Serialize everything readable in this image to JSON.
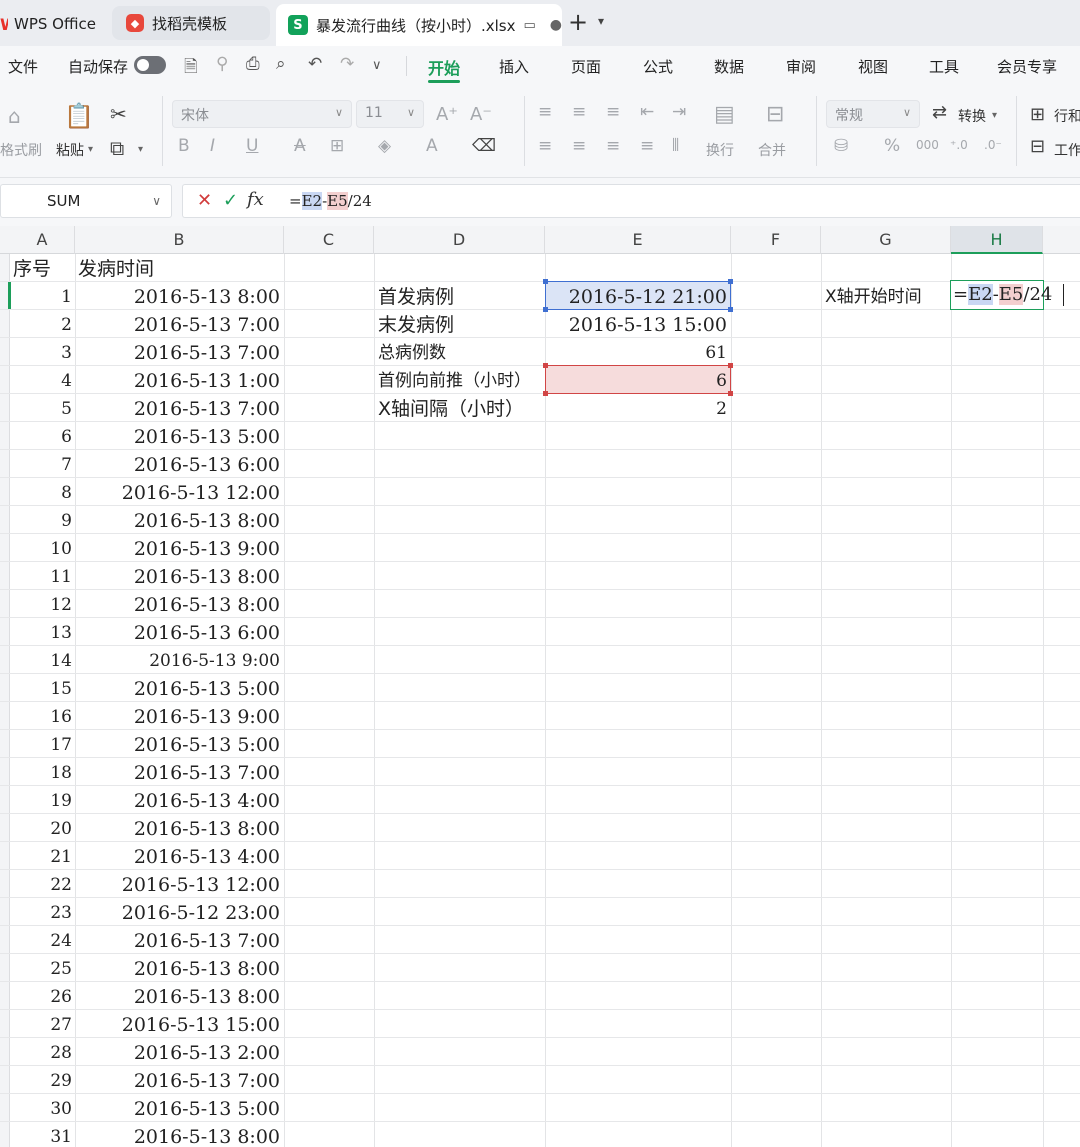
{
  "tabs": [
    {
      "label": "WPS Office"
    },
    {
      "label": "找稻壳模板"
    },
    {
      "label": "暴发流行曲线（按小时）.xlsx"
    }
  ],
  "menu": {
    "file": "文件",
    "autosave": "自动保存",
    "items": [
      "开始",
      "插入",
      "页面",
      "公式",
      "数据",
      "审阅",
      "视图",
      "工具",
      "会员专享"
    ],
    "active": "开始"
  },
  "ribbon": {
    "format_painter": "格式刷",
    "paste": "粘贴",
    "font_name": "宋体",
    "font_size": "11",
    "wrap": "换行",
    "merge": "合并",
    "number_format": "常规",
    "convert": "转换",
    "rows_cols": "行和",
    "worksheet": "工作"
  },
  "formula_bar": {
    "name_box": "SUM",
    "prefix": "=",
    "ref1": "E2",
    "op": "-",
    "ref2": "E5",
    "suffix": "/24"
  },
  "columns": [
    "A",
    "B",
    "C",
    "D",
    "E",
    "F",
    "G",
    "H"
  ],
  "header_row": {
    "a": "序号",
    "b": "发病时间"
  },
  "rows": [
    {
      "n": "1",
      "t": "2016-5-13  8:00"
    },
    {
      "n": "2",
      "t": "2016-5-13  7:00"
    },
    {
      "n": "3",
      "t": "2016-5-13  7:00"
    },
    {
      "n": "4",
      "t": "2016-5-13  1:00"
    },
    {
      "n": "5",
      "t": "2016-5-13  7:00"
    },
    {
      "n": "6",
      "t": "2016-5-13  5:00"
    },
    {
      "n": "7",
      "t": "2016-5-13  6:00"
    },
    {
      "n": "8",
      "t": "2016-5-13  12:00"
    },
    {
      "n": "9",
      "t": "2016-5-13  8:00"
    },
    {
      "n": "10",
      "t": "2016-5-13  9:00"
    },
    {
      "n": "11",
      "t": "2016-5-13  8:00"
    },
    {
      "n": "12",
      "t": "2016-5-13  8:00"
    },
    {
      "n": "13",
      "t": "2016-5-13  6:00"
    },
    {
      "n": "14",
      "t": "2016-5-13  9:00"
    },
    {
      "n": "15",
      "t": "2016-5-13  5:00"
    },
    {
      "n": "16",
      "t": "2016-5-13  9:00"
    },
    {
      "n": "17",
      "t": "2016-5-13  5:00"
    },
    {
      "n": "18",
      "t": "2016-5-13  7:00"
    },
    {
      "n": "19",
      "t": "2016-5-13  4:00"
    },
    {
      "n": "20",
      "t": "2016-5-13  8:00"
    },
    {
      "n": "21",
      "t": "2016-5-13  4:00"
    },
    {
      "n": "22",
      "t": "2016-5-13  12:00"
    },
    {
      "n": "23",
      "t": "2016-5-12  23:00"
    },
    {
      "n": "24",
      "t": "2016-5-13  7:00"
    },
    {
      "n": "25",
      "t": "2016-5-13  8:00"
    },
    {
      "n": "26",
      "t": "2016-5-13  8:00"
    },
    {
      "n": "27",
      "t": "2016-5-13  15:00"
    },
    {
      "n": "28",
      "t": "2016-5-13  2:00"
    },
    {
      "n": "29",
      "t": "2016-5-13  7:00"
    },
    {
      "n": "30",
      "t": "2016-5-13  5:00"
    },
    {
      "n": "31",
      "t": "2016-5-13  8:00"
    }
  ],
  "summary": [
    {
      "label": "首发病例",
      "value": "2016-5-12  21:00"
    },
    {
      "label": "末发病例",
      "value": "2016-5-13  15:00"
    },
    {
      "label": "总病例数",
      "value": "61"
    },
    {
      "label": "首例向前推（小时）",
      "value": "6"
    },
    {
      "label": "X轴间隔（小时）",
      "value": "2"
    }
  ],
  "g2_label": "X轴开始时间",
  "h2_edit": {
    "prefix": "=",
    "ref1": "E2",
    "op": "-",
    "ref2": "E5",
    "suffix": "/24"
  }
}
